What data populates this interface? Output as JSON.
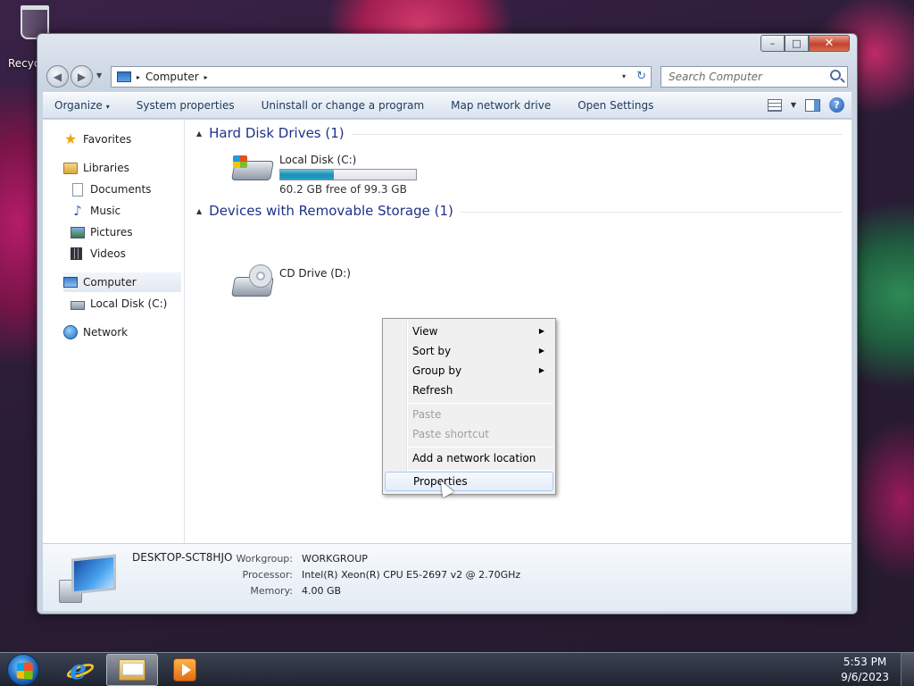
{
  "desktop": {
    "recycle_bin_label": "Recyc"
  },
  "window": {
    "caption": {
      "minimize": "–",
      "maximize": "□",
      "close": "✕"
    },
    "address": {
      "root_arrow": "▸",
      "crumb": "Computer",
      "crumb_arrow": "▸",
      "dropdown": "▾",
      "refresh": "↻"
    },
    "search": {
      "placeholder": "Search Computer"
    },
    "toolbar": {
      "items": [
        {
          "label": "Organize",
          "arrow": "▾"
        },
        {
          "label": "System properties"
        },
        {
          "label": "Uninstall or change a program"
        },
        {
          "label": "Map network drive"
        },
        {
          "label": "Open Settings"
        }
      ],
      "help": "?"
    },
    "navigation": {
      "favorites": "Favorites",
      "libraries": "Libraries",
      "documents": "Documents",
      "music": "Music",
      "pictures": "Pictures",
      "videos": "Videos",
      "computer": "Computer",
      "local_disk": "Local Disk (C:)",
      "network": "Network"
    },
    "groups": {
      "hard_disk": {
        "title": "Hard Disk Drives (1)",
        "toggle": "▲"
      },
      "removable": {
        "title": "Devices with Removable Storage (1)",
        "toggle": "▲"
      }
    },
    "drives": {
      "c": {
        "name": "Local Disk (C:)",
        "free_text": "60.2 GB free of 99.3 GB",
        "used_fraction": 0.394
      },
      "d": {
        "name": "CD Drive (D:)"
      }
    },
    "details": {
      "computer_name": "DESKTOP-SCT8HJO",
      "workgroup_label": "Workgroup:",
      "workgroup_value": "WORKGROUP",
      "processor_label": "Processor:",
      "processor_value": "Intel(R) Xeon(R) CPU E5-2697 v2 @ 2.70GHz",
      "memory_label": "Memory:",
      "memory_value": "4.00 GB"
    }
  },
  "context_menu": {
    "view": "View",
    "sort_by": "Sort by",
    "group_by": "Group by",
    "refresh": "Refresh",
    "paste": "Paste",
    "paste_shortcut": "Paste shortcut",
    "add_network_location": "Add a network location",
    "properties": "Properties",
    "submenu_arrow": "▶"
  },
  "taskbar": {
    "time": "5:53 PM",
    "date": "9/6/2023"
  }
}
